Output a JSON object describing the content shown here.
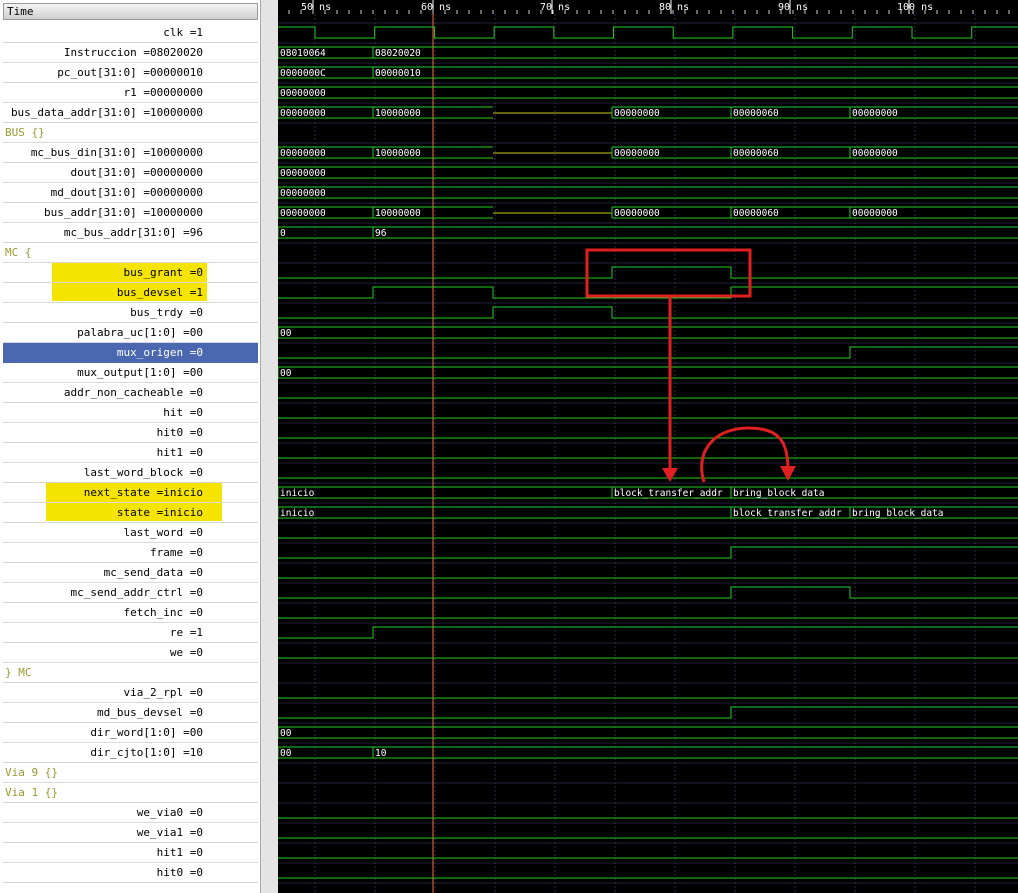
{
  "header": {
    "time_label": "Time"
  },
  "ruler": [
    "50 ns",
    "60 ns",
    "70 ns",
    "80 ns",
    "90 ns",
    "100 ns"
  ],
  "signals": [
    {
      "id": "clk",
      "label": "clk =1"
    },
    {
      "id": "instr",
      "label": "Instruccion =08020020",
      "values": [
        "08010064",
        "08020020"
      ]
    },
    {
      "id": "pc_out",
      "label": "pc_out[31:0] =00000010",
      "values": [
        "0000000C",
        "00000010"
      ]
    },
    {
      "id": "r1",
      "label": "r1 =00000000",
      "values": [
        "00000000"
      ]
    },
    {
      "id": "bus_data_addr",
      "label": "bus_data_addr[31:0] =10000000",
      "values": [
        "00000000",
        "10000000",
        "00000000",
        "00000060",
        "00000000"
      ]
    },
    {
      "id": "grp_bus",
      "label": "BUS {}",
      "group": true
    },
    {
      "id": "mc_bus_din",
      "label": "mc_bus_din[31:0] =10000000",
      "values": [
        "00000000",
        "10000000",
        "00000000",
        "00000060",
        "00000000"
      ]
    },
    {
      "id": "dout",
      "label": "dout[31:0] =00000000",
      "values": [
        "00000000"
      ]
    },
    {
      "id": "md_dout",
      "label": "md_dout[31:0] =00000000",
      "values": [
        "00000000"
      ]
    },
    {
      "id": "bus_addr",
      "label": "bus_addr[31:0] =10000000",
      "values": [
        "00000000",
        "10000000",
        "00000000",
        "00000060",
        "00000000"
      ]
    },
    {
      "id": "mc_bus_addr",
      "label": "mc_bus_addr[31:0] =96",
      "values": [
        "0",
        "96"
      ]
    },
    {
      "id": "grp_mc",
      "label": "MC {",
      "group": true
    },
    {
      "id": "bus_grant",
      "label": "bus_grant =0"
    },
    {
      "id": "bus_devsel",
      "label": "bus_devsel =1"
    },
    {
      "id": "bus_trdy",
      "label": "bus_trdy =0"
    },
    {
      "id": "palabra_uc",
      "label": "palabra_uc[1:0] =00",
      "values": [
        "00"
      ]
    },
    {
      "id": "mux_origen",
      "label": "mux_origen =0"
    },
    {
      "id": "mux_output",
      "label": "mux_output[1:0] =00",
      "values": [
        "00"
      ]
    },
    {
      "id": "addr_non_cacheable",
      "label": "addr_non_cacheable =0"
    },
    {
      "id": "hit",
      "label": "hit =0"
    },
    {
      "id": "hit0",
      "label": "hit0 =0"
    },
    {
      "id": "hit1",
      "label": "hit1 =0"
    },
    {
      "id": "last_word_block",
      "label": "last_word_block =0"
    },
    {
      "id": "next_state",
      "label": "next_state =inicio",
      "values": [
        "inicio",
        "block_transfer_addr",
        "bring_block_data"
      ]
    },
    {
      "id": "state",
      "label": "state =inicio",
      "values": [
        "inicio",
        "block_transfer_addr",
        "bring_block_data"
      ]
    },
    {
      "id": "last_word",
      "label": "last_word =0"
    },
    {
      "id": "frame",
      "label": "frame =0"
    },
    {
      "id": "mc_send_data",
      "label": "mc_send_data =0"
    },
    {
      "id": "mc_send_addr_ctrl",
      "label": "mc_send_addr_ctrl =0"
    },
    {
      "id": "fetch_inc",
      "label": "fetch_inc =0"
    },
    {
      "id": "re",
      "label": "re =1"
    },
    {
      "id": "we",
      "label": "we =0"
    },
    {
      "id": "grp_mc_end",
      "label": "} MC",
      "group": true
    },
    {
      "id": "via_2_rpl",
      "label": "via_2_rpl =0"
    },
    {
      "id": "md_bus_devsel",
      "label": "md_bus_devsel =0"
    },
    {
      "id": "dir_word",
      "label": "dir_word[1:0] =00",
      "values": [
        "00"
      ]
    },
    {
      "id": "dir_cjto",
      "label": "dir_cjto[1:0] =10",
      "values": [
        "00",
        "10"
      ]
    },
    {
      "id": "grp_via9",
      "label": "Via 9 {}",
      "group": true
    },
    {
      "id": "grp_via1",
      "label": "Via 1 {}",
      "group": true
    },
    {
      "id": "we_via0",
      "label": "we_via0 =0"
    },
    {
      "id": "we_via1",
      "label": "we_via1 =0"
    },
    {
      "id": "hit1b",
      "label": "hit1 =0"
    },
    {
      "id": "hit0b",
      "label": "hit0 =0"
    }
  ],
  "colors": {
    "wave": "#22cc22",
    "wave_mid": "#c8c800",
    "cursor": "#ff6a3a",
    "annotation": "#e02020",
    "highlight": "#f5e400",
    "selected": "#4a67b0"
  }
}
